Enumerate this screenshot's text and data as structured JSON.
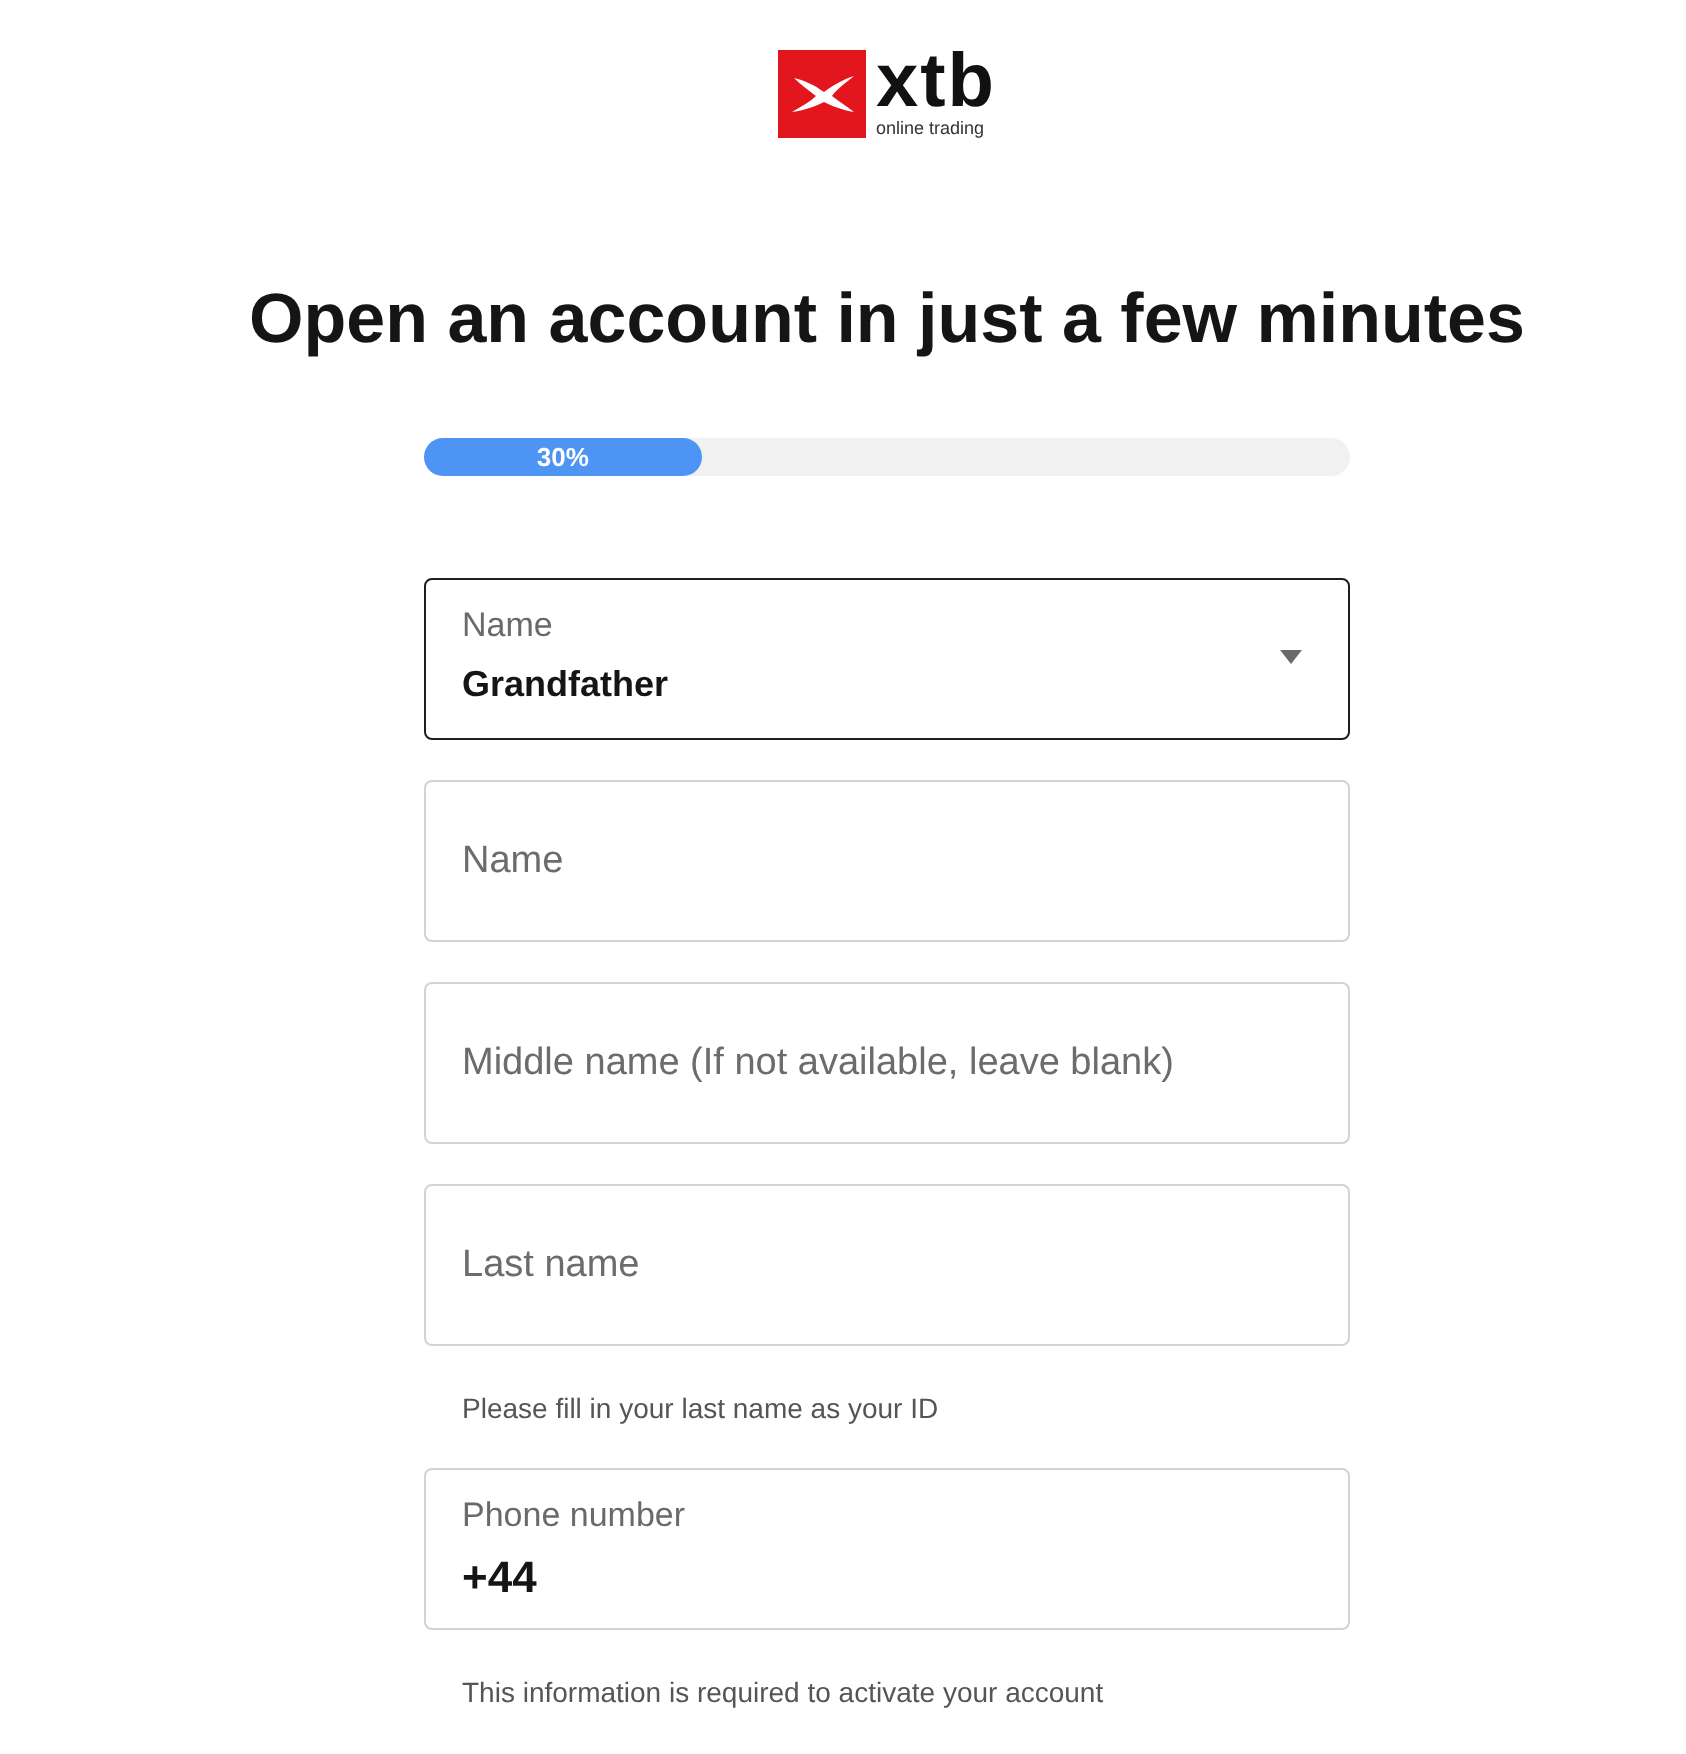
{
  "logo": {
    "wordmark": "xtb",
    "tagline": "online trading"
  },
  "heading": "Open an account in just a few minutes",
  "progress": {
    "label": "30%",
    "level": 0.3
  },
  "fields": [
    {
      "kind": "select",
      "label": "Name",
      "value": "Grandfather"
    },
    {
      "kind": "text",
      "placeholder": "Name"
    },
    {
      "kind": "text",
      "placeholder": "Middle name (If not available, leave blank)"
    },
    {
      "kind": "text",
      "placeholder": "Last name",
      "helper": "Please fill in your last name as your ID"
    },
    {
      "kind": "phone",
      "label": "Phone number",
      "value": "+44",
      "helper": "This information is required to activate your account"
    }
  ]
}
